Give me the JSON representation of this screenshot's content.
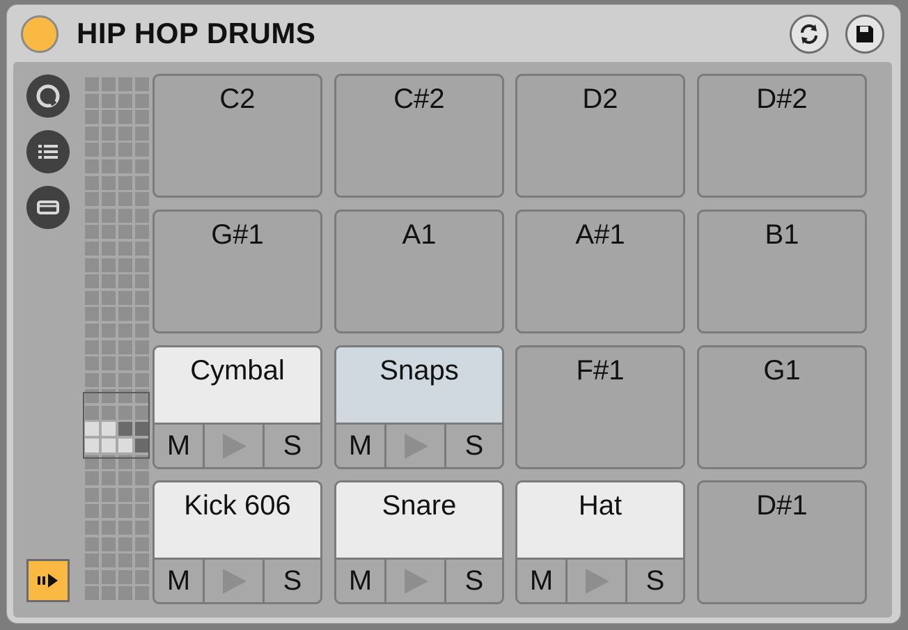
{
  "title": "HIP HOP DRUMS",
  "colors": {
    "accent": "#f9b943",
    "pad_bg": "#a5a5a5",
    "pad_filled": "#ebebeb",
    "pad_selected": "#cfd9df",
    "panel_bg": "#a9a9a9"
  },
  "icons": {
    "power": "circle-dot-icon",
    "sync": "sync-arrows-icon",
    "save": "save-disk-icon",
    "side": [
      "chain-view-icon",
      "list-icon",
      "device-slot-icon"
    ],
    "follow": "follow-play-icon"
  },
  "controls": {
    "mute_label": "M",
    "solo_label": "S"
  },
  "pads": [
    [
      {
        "label": "C2"
      },
      {
        "label": "C#2"
      },
      {
        "label": "D2"
      },
      {
        "label": "D#2"
      }
    ],
    [
      {
        "label": "G#1"
      },
      {
        "label": "A1"
      },
      {
        "label": "A#1"
      },
      {
        "label": "B1"
      }
    ],
    [
      {
        "label": "Cymbal",
        "filled": true
      },
      {
        "label": "Snaps",
        "filled": true,
        "selected": true
      },
      {
        "label": "F#1"
      },
      {
        "label": "G1"
      }
    ],
    [
      {
        "label": "Kick 606",
        "filled": true
      },
      {
        "label": "Snare",
        "filled": true
      },
      {
        "label": "Hat",
        "filled": true
      },
      {
        "label": "D#1"
      }
    ]
  ]
}
